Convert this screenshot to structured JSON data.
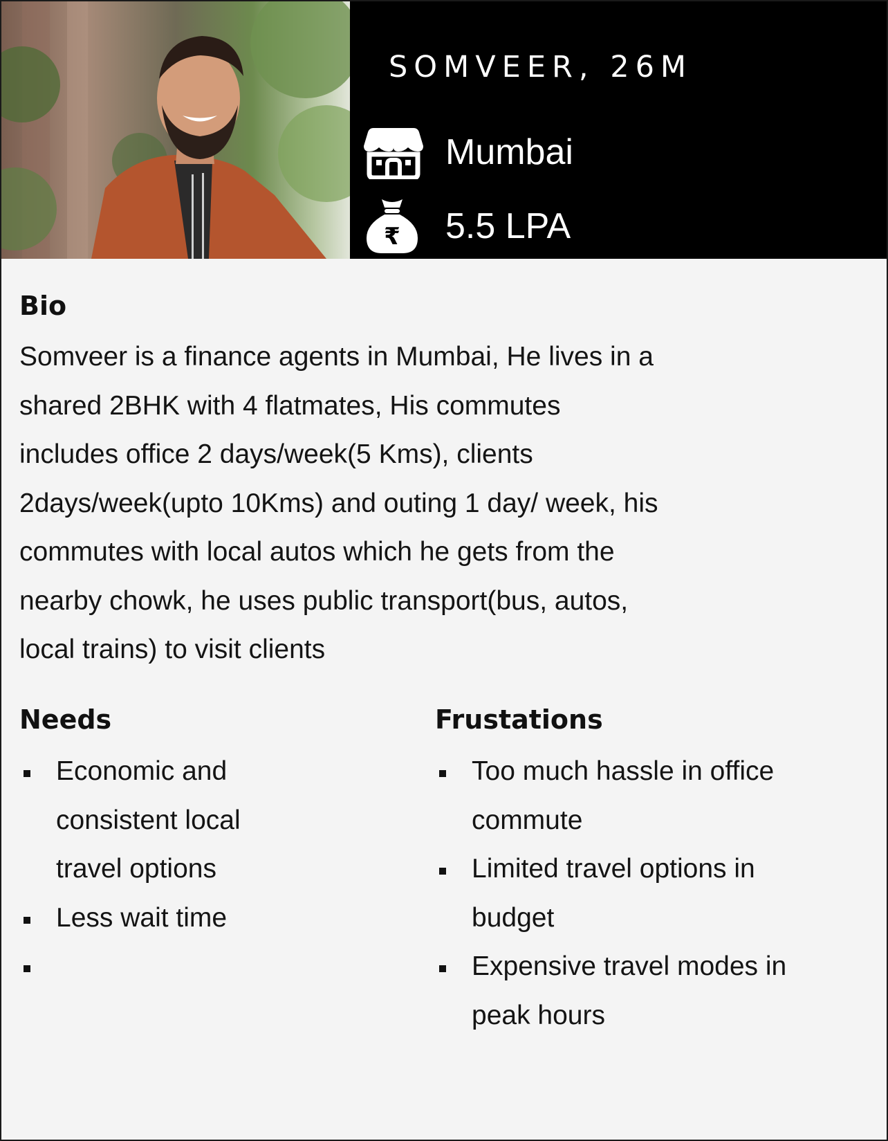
{
  "profile": {
    "name": "SOMVEER, 26M",
    "city": "Mumbai",
    "salary": "5.5 LPA",
    "city_icon": "store-house-icon",
    "salary_icon": "rupee-money-bag-icon"
  },
  "bio": {
    "title": "Bio",
    "text": "Somveer is a  finance agents in Mumbai, He lives in a\nshared 2BHK with 4 flatmates, His commutes\nincludes office 2 days/week(5 Kms), clients\n2days/week(upto 10Kms) and outing 1 day/ week, his\ncommutes with local autos which he gets from the\nnearby chowk, he uses public transport(bus, autos,\nlocal trains) to visit clients"
  },
  "needs": {
    "title": "Needs",
    "items": [
      "Economic and\nconsistent local\ntravel options",
      "Less wait time",
      ""
    ]
  },
  "frustrations": {
    "title": "Frustations",
    "items": [
      "Too much hassle in office\ncommute",
      "Limited travel options in\nbudget",
      "Expensive travel modes in\npeak hours"
    ]
  },
  "colors": {
    "header_bg": "#000000",
    "card_bg": "#f4f4f4",
    "text": "#141414"
  }
}
